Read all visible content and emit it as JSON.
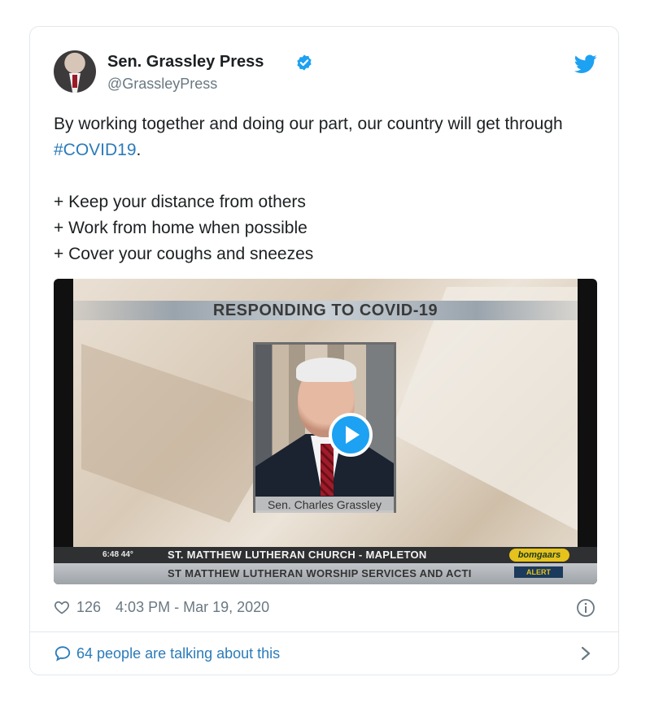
{
  "colors": {
    "accent": "#2b7bb9",
    "twitter_blue": "#1da1f2",
    "muted": "#697882",
    "text": "#1c2022",
    "border": "#e1e8ed"
  },
  "tweet": {
    "author_name": "Sen. Grassley Press",
    "handle": "@GrassleyPress",
    "text_before": "By working together and doing our part, our country will get through ",
    "hashtag": "#COVID19",
    "text_after": ".\n\n+ Keep your distance from others\n+ Work from home when possible\n+ Cover your coughs and sneezes",
    "icons": {
      "verified": "verified-badge-icon",
      "logo": "twitter-bird-icon"
    }
  },
  "video": {
    "headline": "RESPONDING TO COVID-19",
    "nameplate": "Sen. Charles Grassley",
    "ticker_time": "6:48  44°",
    "ticker_top": "ST. MATTHEW LUTHERAN CHURCH - MAPLETON",
    "ticker_bottom": "ST MATTHEW LUTHERAN WORSHIP SERVICES AND ACTI",
    "sponsor": "bomgaars",
    "alert": "ALERT",
    "play_icon": "play-icon"
  },
  "footer": {
    "likes": "126",
    "timestamp": "4:03 PM - Mar 19, 2020",
    "talking": "64 people are talking about this"
  }
}
